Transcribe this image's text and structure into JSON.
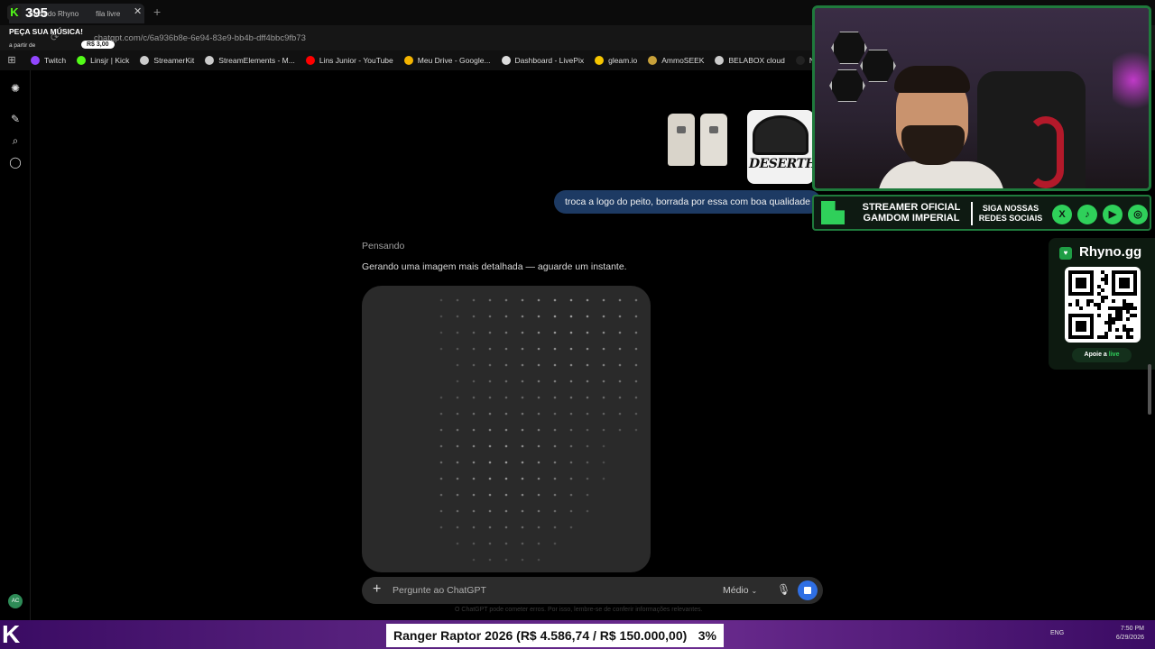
{
  "browser": {
    "tab_title": "Baba do Rhyno",
    "tab2_title": "fila livre",
    "url": "chatgpt.com/c/6a936b8e-6e94-83e9-bb4b-dff4bbc9fb73",
    "bookmarks": [
      {
        "label": "Twitch",
        "color": "#9146ff"
      },
      {
        "label": "Linsjr | Kick",
        "color": "#53fc18"
      },
      {
        "label": "StreamerKit",
        "color": "#cccccc"
      },
      {
        "label": "StreamElements - M...",
        "color": "#cccccc"
      },
      {
        "label": "Lins Junior - YouTube",
        "color": "#ff0000"
      },
      {
        "label": "Meu Drive - Google...",
        "color": "#f4b400"
      },
      {
        "label": "Dashboard - LivePix",
        "color": "#dddddd"
      },
      {
        "label": "gleam.io",
        "color": "#f7c600"
      },
      {
        "label": "AmmoSEEK",
        "color": "#c8a13a"
      },
      {
        "label": "BELABOX cloud",
        "color": "#cccccc"
      },
      {
        "label": "Nightbot - Comm...",
        "color": "#222222"
      }
    ]
  },
  "overlay_tl": {
    "count": "395",
    "cta": "PEÇA SUA MÚSICA!",
    "from": "a partir de",
    "price": "R$ 3,00"
  },
  "chat": {
    "image_label": "DESERTHO",
    "user_message": "troca a logo do peito, borrada por essa com boa qualidade",
    "thinking": "Pensando",
    "status": "Gerando uma imagem mais detalhada — aguarde um instante.",
    "input_placeholder": "Pergunte ao ChatGPT",
    "model": "Médio",
    "disclaimer": "O ChatGPT pode cometer erros. Por isso, lembre-se de conferir informações relevantes.",
    "avatar_initials": "AC"
  },
  "stream": {
    "banner_line1": "STREAMER OFICIAL",
    "banner_line2": "GAMDOM IMPERIAL",
    "banner_follow1": "SIGA NOSSAS",
    "banner_follow2": "REDES SOCIAIS",
    "socials": [
      "X",
      "♪",
      "▶",
      "◎"
    ],
    "qr_title": "Rhyno.gg",
    "qr_button_1": "Apoie a",
    "qr_button_2": "live",
    "goal_text": "Ranger Raptor 2026 (R$ 4.586,74 / R$ 150.000,00)",
    "goal_pct": "3%",
    "goal_progress_fraction": 0.03
  },
  "taskbar": {
    "lang": "ENG",
    "time": "7:50 PM",
    "date": "6/29/2026"
  }
}
